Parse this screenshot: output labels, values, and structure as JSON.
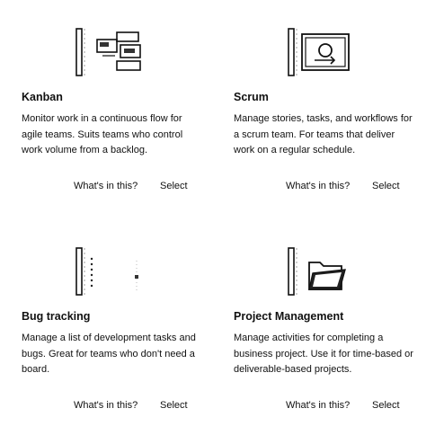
{
  "templates": [
    {
      "title": "Kanban",
      "description": "Monitor work in a continuous flow for agile teams. Suits teams who control work volume from a backlog.",
      "whats_in_this": "What's in this?",
      "select": "Select",
      "icon": "kanban-board-icon"
    },
    {
      "title": "Scrum",
      "description": "Manage stories, tasks, and workflows for a scrum team. For teams that deliver work on a regular schedule.",
      "whats_in_this": "What's in this?",
      "select": "Select",
      "icon": "scrum-sprint-icon"
    },
    {
      "title": "Bug tracking",
      "description": "Manage a list of development tasks and bugs. Great for teams who don't need a board.",
      "whats_in_this": "What's in this?",
      "select": "Select",
      "icon": "bug-list-icon"
    },
    {
      "title": "Project Management",
      "description": "Manage activities for completing a business project. Use it for time-based or deliverable-based projects.",
      "whats_in_this": "What's in this?",
      "select": "Select",
      "icon": "folder-icon"
    }
  ]
}
